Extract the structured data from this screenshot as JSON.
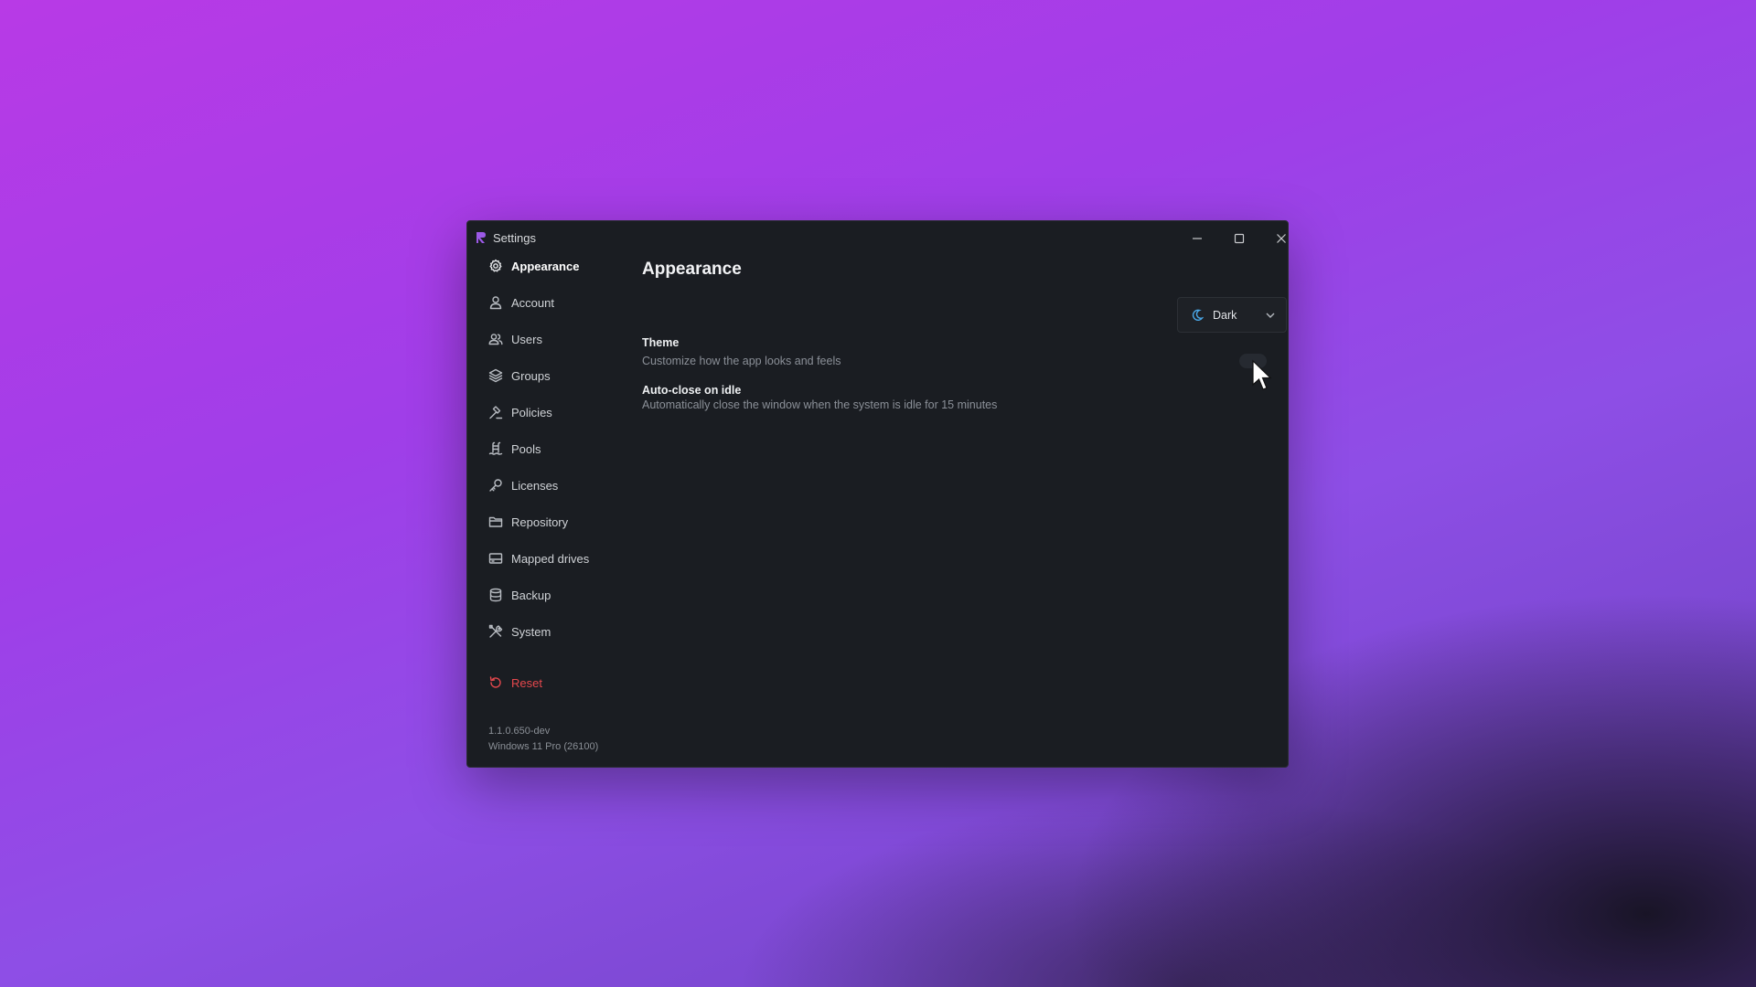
{
  "window": {
    "title": "Settings",
    "controls": {
      "minimize": "minimize-icon",
      "maximize": "maximize-icon",
      "close": "close-icon"
    }
  },
  "sidebar": {
    "items": [
      {
        "label": "Appearance",
        "icon": "gear-icon",
        "active": true
      },
      {
        "label": "Account",
        "icon": "user-icon"
      },
      {
        "label": "Users",
        "icon": "users-icon"
      },
      {
        "label": "Groups",
        "icon": "layers-icon"
      },
      {
        "label": "Policies",
        "icon": "gavel-icon"
      },
      {
        "label": "Pools",
        "icon": "pool-icon"
      },
      {
        "label": "Licenses",
        "icon": "key-icon"
      },
      {
        "label": "Repository",
        "icon": "folder-icon"
      },
      {
        "label": "Mapped drives",
        "icon": "drive-icon"
      },
      {
        "label": "Backup",
        "icon": "database-icon"
      },
      {
        "label": "System",
        "icon": "tools-icon"
      }
    ],
    "reset": {
      "label": "Reset",
      "icon": "undo-icon",
      "color": "#e5484d"
    },
    "version": "1.1.0.650-dev",
    "os": "Windows 11 Pro (26100)"
  },
  "main": {
    "title": "Appearance",
    "settings": {
      "theme": {
        "title": "Theme",
        "description": "Customize how the app looks and feels",
        "value": "Dark",
        "icon": "moon-icon"
      },
      "auto_close": {
        "title": "Auto-close on idle",
        "description": "Automatically close the window when the system is idle for 15 minutes",
        "enabled": false
      }
    }
  },
  "colors": {
    "window_bg": "#1a1d22",
    "accent": "#9b59e6",
    "danger": "#e5484d",
    "moon": "#4aa8e8"
  }
}
